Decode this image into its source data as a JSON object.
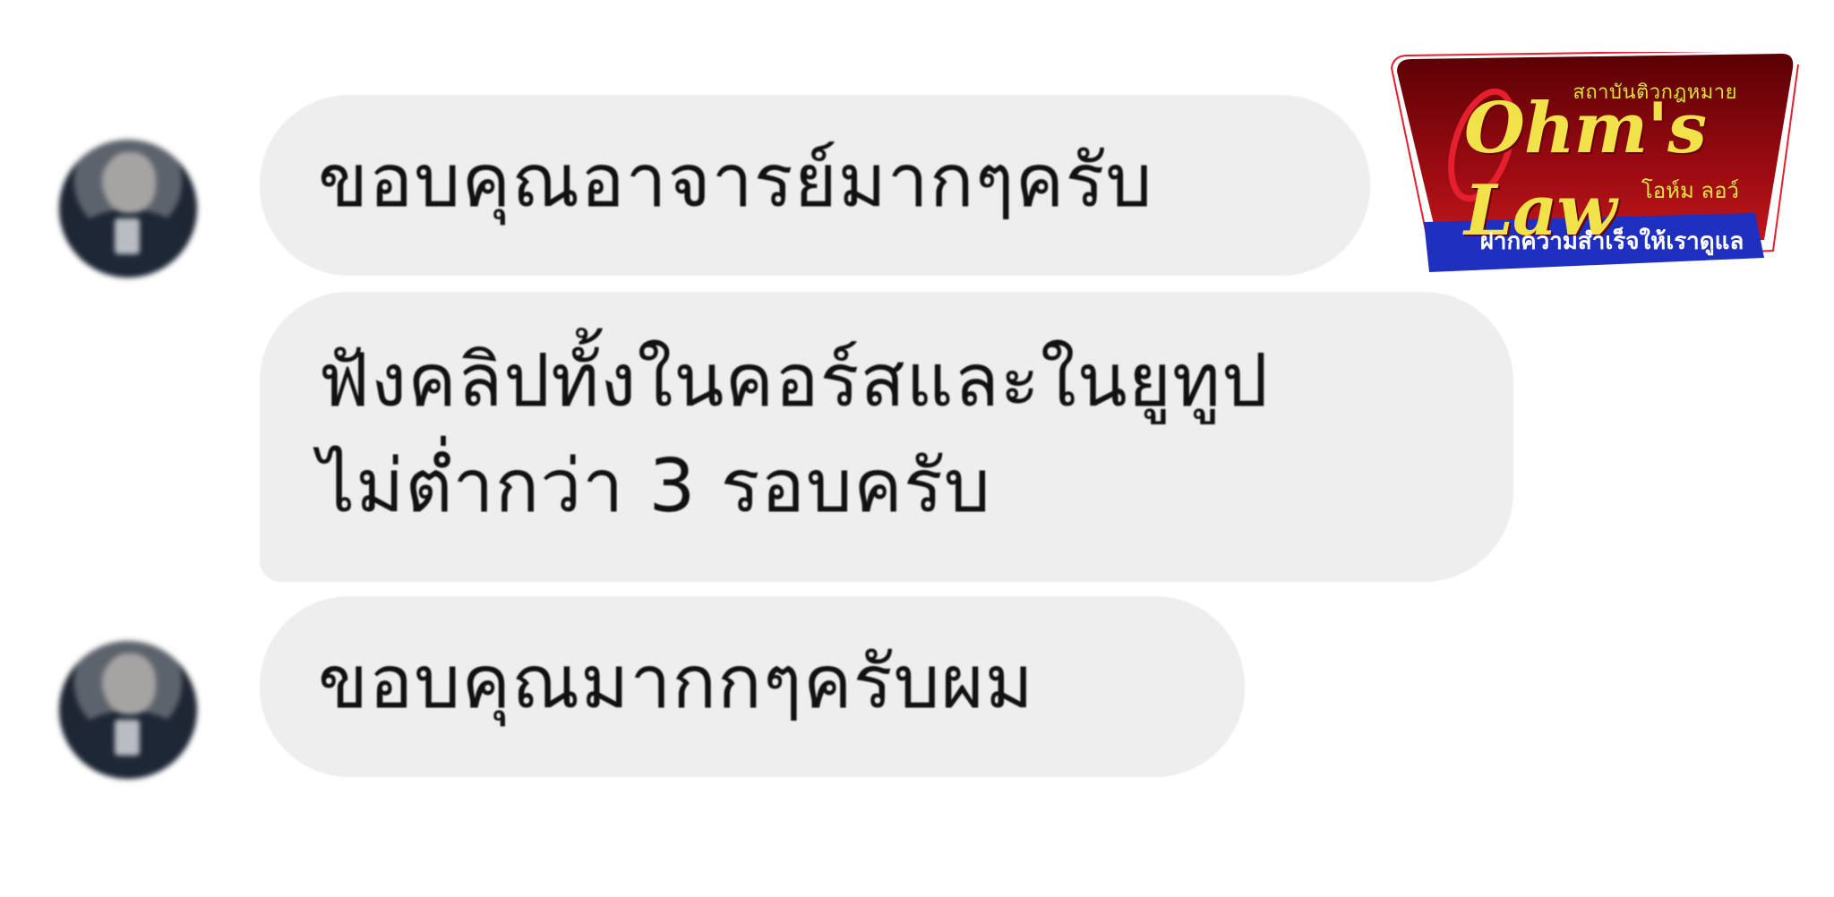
{
  "messages": [
    {
      "text": "ขอบคุณอาจารย์มากๆครับ"
    },
    {
      "lines": [
        "ฟังคลิปทั้งในคอร์สและในยูทูป",
        "ไม่ต่ำกว่า 3 รอบครับ"
      ]
    },
    {
      "text": "ขอบคุณมากกๆครับผม"
    }
  ],
  "logo": {
    "top_text": "สถาบันติวกฎหมาย",
    "brand": "Ohm's Law",
    "sub_text": "โอห์ม ลอว์",
    "tagline": "ฝากความสำเร็จให้เราดูแล",
    "colors": {
      "plaque": "#8b0a0e",
      "ribbon": "#1f2fc0",
      "accent": "#e61f2e",
      "gold": "#f2e24a"
    }
  }
}
